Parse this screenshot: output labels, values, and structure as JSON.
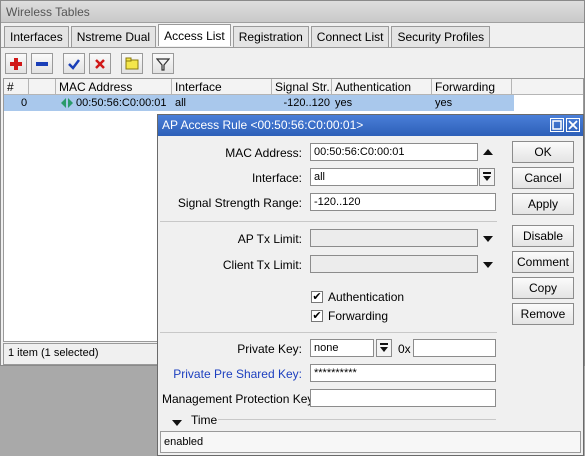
{
  "window": {
    "title": "Wireless Tables"
  },
  "tabs": [
    {
      "label": "Interfaces"
    },
    {
      "label": "Nstreme Dual"
    },
    {
      "label": "Access List"
    },
    {
      "label": "Registration"
    },
    {
      "label": "Connect List"
    },
    {
      "label": "Security Profiles"
    }
  ],
  "toolbar": {
    "add_icon": "plus-icon",
    "remove_icon": "minus-icon",
    "enable_icon": "check-icon",
    "disable_icon": "x-icon",
    "comment_icon": "note-icon",
    "filter_icon": "filter-icon"
  },
  "table": {
    "columns": [
      "#",
      "MAC Address",
      "Interface",
      "Signal Str...",
      "Authentication",
      "Forwarding"
    ],
    "rows": [
      {
        "num": "0",
        "mac": "00:50:56:C0:00:01",
        "interface": "all",
        "signal": "-120..120",
        "auth": "yes",
        "fwd": "yes"
      }
    ]
  },
  "status": {
    "text": "1 item (1 selected)"
  },
  "dialog": {
    "title": "AP Access Rule <00:50:56:C0:00:01>",
    "mac_label": "MAC Address:",
    "mac_value": "00:50:56:C0:00:01",
    "interface_label": "Interface:",
    "interface_value": "all",
    "signal_label": "Signal Strength Range:",
    "signal_value": "-120..120",
    "ap_tx_label": "AP Tx Limit:",
    "client_tx_label": "Client Tx Limit:",
    "auth_label": "Authentication",
    "fwd_label": "Forwarding",
    "private_key_label": "Private Key:",
    "private_key_value": "none",
    "hex_prefix": "0x",
    "psk_label": "Private Pre Shared Key:",
    "psk_value": "**********",
    "mgmt_label": "Management Protection Key:",
    "time_label": "Time",
    "status_text": "enabled",
    "buttons": {
      "ok": "OK",
      "cancel": "Cancel",
      "apply": "Apply",
      "disable": "Disable",
      "comment": "Comment",
      "copy": "Copy",
      "remove": "Remove"
    }
  },
  "colors": {
    "selection": "#a9c8ec",
    "dialog_title": "#2d5fb8",
    "link_label": "#1c3fbf",
    "add_red": "#d01818",
    "check_blue": "#1a3fb8"
  }
}
